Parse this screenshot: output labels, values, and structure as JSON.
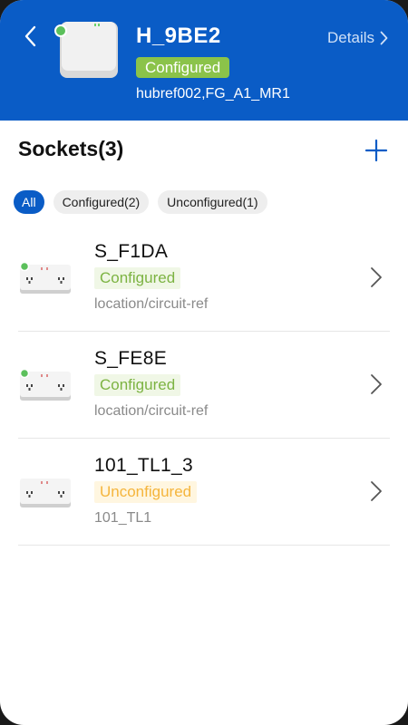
{
  "header": {
    "hub_name": "H_9BE2",
    "status": "Configured",
    "reference": "hubref002,FG_A1_MR1",
    "details_label": "Details",
    "online_indicator_color": "#5cc05c"
  },
  "section": {
    "title": "Sockets(3)"
  },
  "filters": [
    {
      "label": "All",
      "active": true
    },
    {
      "label": "Configured(2)",
      "active": false
    },
    {
      "label": "Unconfigured(1)",
      "active": false
    }
  ],
  "sockets": [
    {
      "name": "S_F1DA",
      "status": "Configured",
      "status_type": "configured",
      "location": "location/circuit-ref",
      "online": true
    },
    {
      "name": "S_FE8E",
      "status": "Configured",
      "status_type": "configured",
      "location": "location/circuit-ref",
      "online": true
    },
    {
      "name": "101_TL1_3",
      "status": "Unconfigured",
      "status_type": "unconfigured",
      "location": "101_TL1",
      "online": false
    }
  ],
  "colors": {
    "brand_blue": "#0a5cc6",
    "configured_green": "#8bc34a",
    "unconfigured_orange": "#f5b53c"
  },
  "icons": {
    "back": "chevron-left-icon",
    "details": "chevron-right-icon",
    "add": "plus-icon",
    "row": "chevron-right-icon"
  }
}
